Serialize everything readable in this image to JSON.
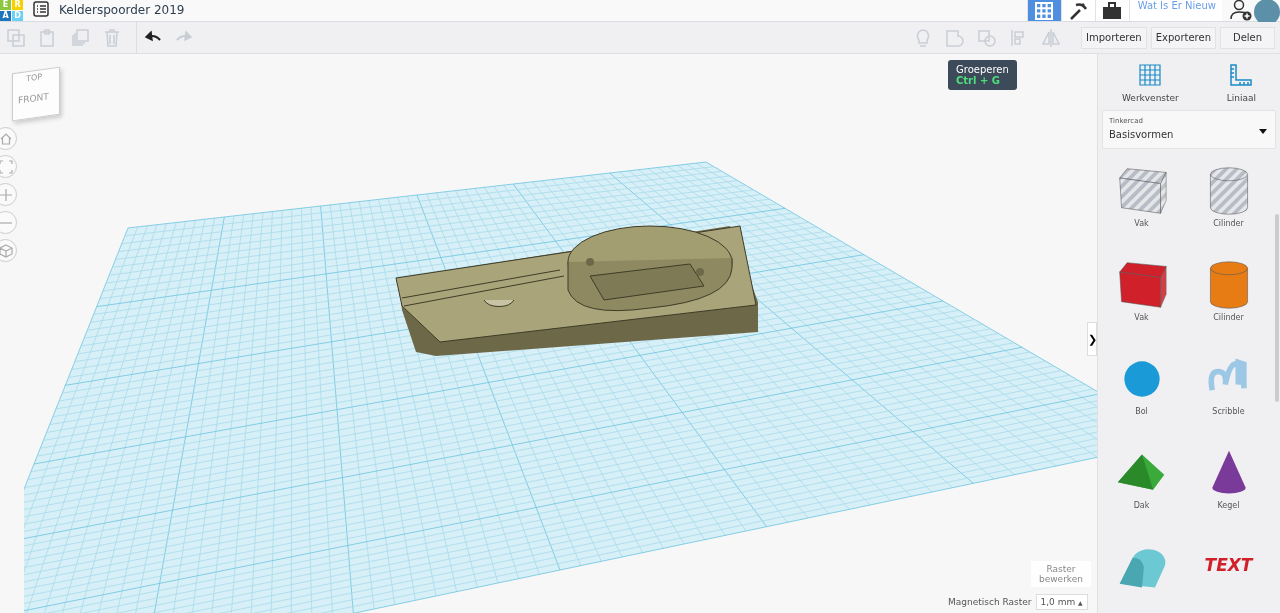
{
  "logo": {
    "letters": [
      {
        "char": "E",
        "color": "#8dc63f"
      },
      {
        "char": "R",
        "color": "#f6d000"
      },
      {
        "char": "A",
        "color": "#1c75bc"
      },
      {
        "char": "D",
        "color": "#6dcff6"
      }
    ]
  },
  "title": "Kelderspoorder 2019",
  "top_tabs": [
    {
      "kind": "grid",
      "selected": true
    },
    {
      "kind": "tools",
      "selected": false
    },
    {
      "kind": "briefcase",
      "selected": false
    }
  ],
  "whats_new": "Wat Is Er Nieuw",
  "edit_tools": [
    {
      "kind": "copy",
      "disabled": true
    },
    {
      "kind": "paste",
      "disabled": true
    },
    {
      "kind": "duplicate",
      "disabled": true
    },
    {
      "kind": "delete",
      "disabled": true
    },
    {
      "kind": "undo",
      "disabled": false
    },
    {
      "kind": "redo",
      "disabled": true
    }
  ],
  "shape_tools": [
    {
      "kind": "bulb",
      "disabled": true
    },
    {
      "kind": "group",
      "disabled": true
    },
    {
      "kind": "ungroup",
      "disabled": true
    },
    {
      "kind": "align",
      "disabled": true
    },
    {
      "kind": "mirror",
      "disabled": true
    }
  ],
  "actions": [
    "Importeren",
    "Exporteren",
    "Delen"
  ],
  "tooltip": {
    "title": "Groeperen",
    "shortcut": "Ctrl + G"
  },
  "view_cube": {
    "top": "TOP",
    "front": "FRONT"
  },
  "view_controls": [
    {
      "kind": "home"
    },
    {
      "kind": "fit"
    },
    {
      "kind": "zoom-in"
    },
    {
      "kind": "zoom-out"
    },
    {
      "kind": "ortho"
    }
  ],
  "grid_controls": {
    "edit_grid": "Raster bewerken",
    "snap_label": "Magnetisch Raster",
    "snap_value": "1,0 mm",
    "snap_caret": "▲"
  },
  "panel": {
    "tools": [
      {
        "kind": "workplane",
        "label": "Werkvenster"
      },
      {
        "kind": "ruler",
        "label": "Liniaal"
      }
    ],
    "library": {
      "caption": "Tinkercad",
      "value": "Basisvormen"
    },
    "collapse": "❯",
    "shapes": [
      {
        "kind": "hole-box",
        "label": "Vak",
        "color": "#b8bcc4"
      },
      {
        "kind": "hole-cylinder",
        "label": "Cilinder",
        "color": "#b8bcc4"
      },
      {
        "kind": "box",
        "label": "Vak",
        "color": "#d0202a"
      },
      {
        "kind": "cylinder",
        "label": "Cilinder",
        "color": "#e87c14"
      },
      {
        "kind": "sphere",
        "label": "Bol",
        "color": "#1a9ad6"
      },
      {
        "kind": "scribble",
        "label": "Scribble",
        "color": "#9cc8e6"
      },
      {
        "kind": "roof",
        "label": "Dak",
        "color": "#3aaa3a"
      },
      {
        "kind": "cone",
        "label": "Kegel",
        "color": "#7a3a9a"
      },
      {
        "kind": "halfcyl",
        "color": "#6cc8d2"
      },
      {
        "kind": "text",
        "art": "TEXT",
        "color": "#d0202a"
      }
    ]
  }
}
